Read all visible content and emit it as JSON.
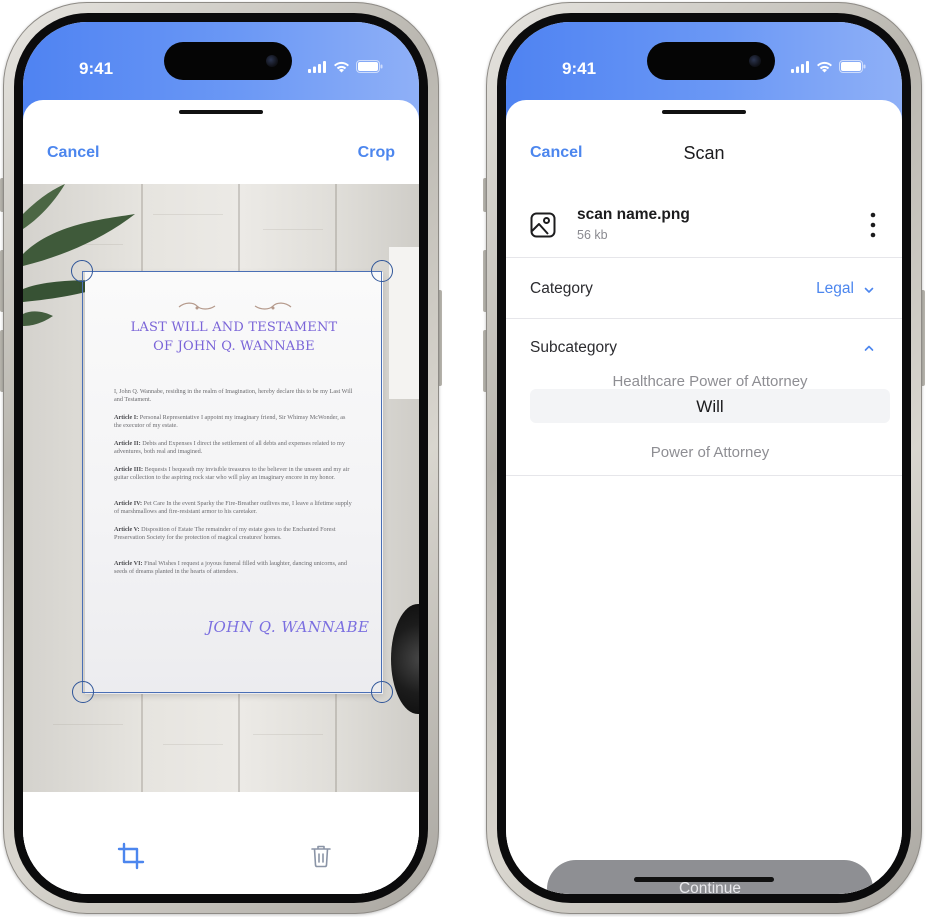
{
  "status_bar": {
    "time": "9:41"
  },
  "crop_screen": {
    "cancel_label": "Cancel",
    "crop_label": "Crop",
    "document": {
      "title_line1": "LAST WILL AND TESTAMENT",
      "title_line2": "OF JOHN Q. WANNABE",
      "intro": "I, John Q. Wannabe, residing in the realm of Imagination, hereby declare this to be my Last Will and Testament.",
      "articles": [
        {
          "heading": "Article I:",
          "text": "Personal Representative I appoint my imaginary friend, Sir Whimsy McWonder, as the executor of my estate."
        },
        {
          "heading": "Article II:",
          "text": "Debts and Expenses I direct the settlement of all debts and expenses related to my adventures, both real and imagined."
        },
        {
          "heading": "Article III:",
          "text": "Bequests I bequeath my invisible treasures to the believer in the unseen and my air guitar collection to the aspiring rock star who will play an imaginary encore in my honor."
        },
        {
          "heading": "Article IV:",
          "text": "Pet Care In the event Sparky the Fire-Breather outlives me, I leave a lifetime supply of marshmallows and fire-resistant armor to his caretaker."
        },
        {
          "heading": "Article V:",
          "text": "Disposition of Estate The remainder of my estate goes to the Enchanted Forest Preservation Society for the protection of magical creatures' homes."
        },
        {
          "heading": "Article VI:",
          "text": "Final Wishes I request a joyous funeral filled with laughter, dancing unicorns, and seeds of dreams planted in the hearts of attendees."
        }
      ],
      "signature": "JOHN Q. WANNABE"
    },
    "toolbar": {
      "crop_icon": "crop-icon",
      "delete_icon": "trash-icon"
    }
  },
  "scan_screen": {
    "cancel_label": "Cancel",
    "title": "Scan",
    "file": {
      "name": "scan name.png",
      "size": "56 kb",
      "icon": "image-icon"
    },
    "category": {
      "label": "Category",
      "value": "Legal"
    },
    "subcategory": {
      "label": "Subcategory",
      "options": [
        "Healthcare Power of Attorney",
        "Will",
        "Power of Attorney"
      ],
      "selected": "Will"
    },
    "continue_label": "Continue"
  },
  "colors": {
    "accent": "#4c86ee",
    "status_bar": "#5b8cf3",
    "button_disabled": "#8e8f93"
  }
}
